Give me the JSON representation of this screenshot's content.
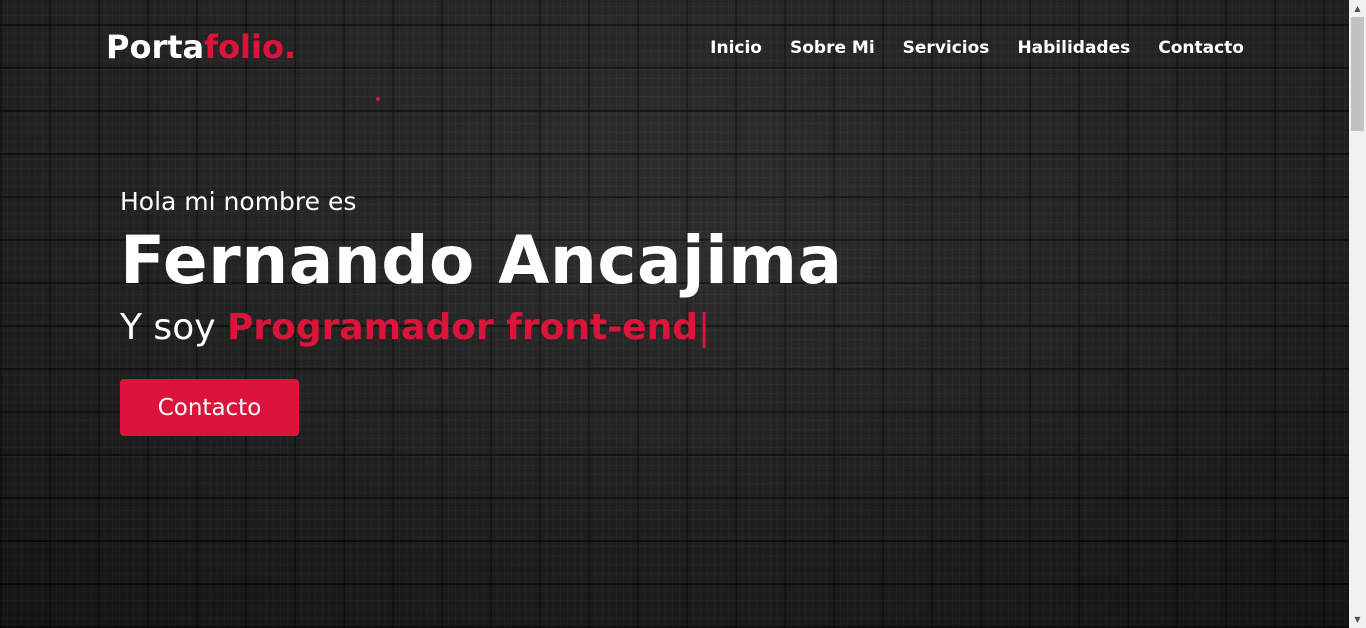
{
  "brand": {
    "logo_main": "Porta",
    "logo_accent": "folio."
  },
  "nav": {
    "items": [
      "Inicio",
      "Sobre Mi",
      "Servicios",
      "Habilidades",
      "Contacto"
    ]
  },
  "hero": {
    "greeting": "Hola mi nombre es",
    "name": "Fernando Ancajima",
    "role_prefix": "Y soy ",
    "role_highlight": "Programador front-end",
    "cursor": "|",
    "cta_label": "Contacto"
  },
  "colors": {
    "accent": "#dc143c",
    "text": "#ffffff",
    "background": "#1f1f1f"
  },
  "icons": {
    "scroll_up": "triangle-up-icon",
    "scroll_down": "triangle-down-icon"
  }
}
